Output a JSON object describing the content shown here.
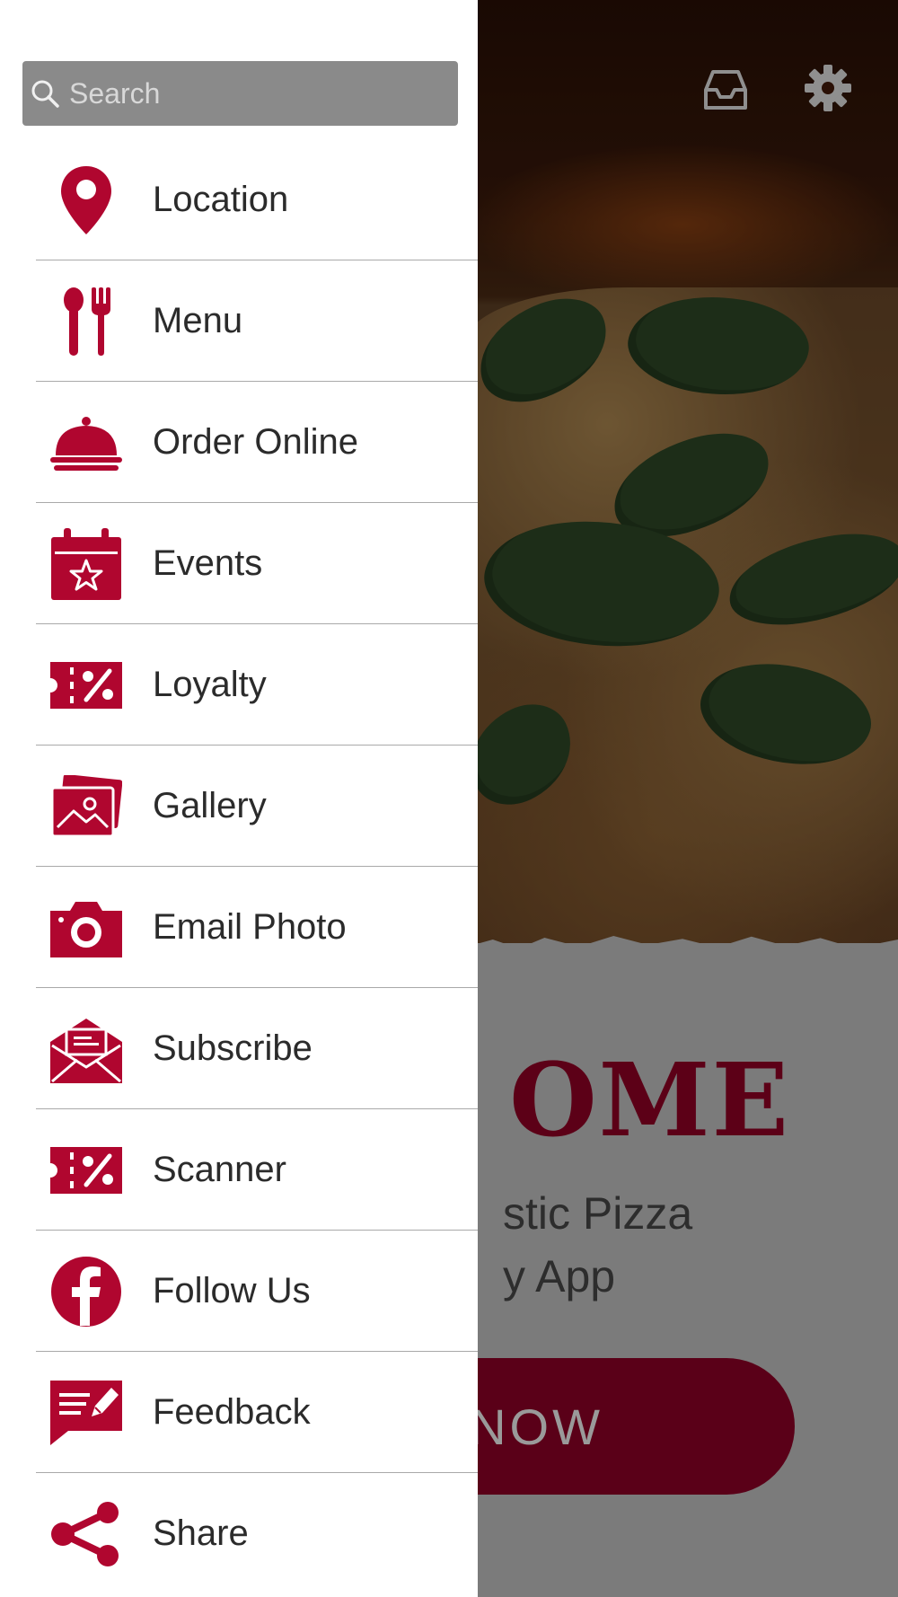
{
  "colors": {
    "accent": "#b0062f",
    "overlay": "#7b7b7b",
    "drawer_bg": "#ffffff",
    "button_bg": "#5a0018"
  },
  "search": {
    "placeholder": "Search",
    "icon": "search-icon"
  },
  "menu_items": [
    {
      "label": "Location",
      "icon": "location-pin-icon"
    },
    {
      "label": "Menu",
      "icon": "spoon-fork-icon"
    },
    {
      "label": "Order Online",
      "icon": "cloche-icon"
    },
    {
      "label": "Events",
      "icon": "calendar-star-icon"
    },
    {
      "label": "Loyalty",
      "icon": "percent-ticket-icon"
    },
    {
      "label": "Gallery",
      "icon": "photos-icon"
    },
    {
      "label": "Email Photo",
      "icon": "camera-icon"
    },
    {
      "label": "Subscribe",
      "icon": "envelope-icon"
    },
    {
      "label": "Scanner",
      "icon": "percent-ticket-icon"
    },
    {
      "label": "Follow Us",
      "icon": "facebook-icon"
    },
    {
      "label": "Feedback",
      "icon": "feedback-icon"
    },
    {
      "label": "Share",
      "icon": "share-icon"
    }
  ],
  "background": {
    "welcome_partial": "OME",
    "tagline_line1": "stic Pizza",
    "tagline_line2": "y App",
    "cta_partial": "NOW",
    "header_icons": [
      "inbox-icon",
      "settings-gear-icon"
    ]
  }
}
